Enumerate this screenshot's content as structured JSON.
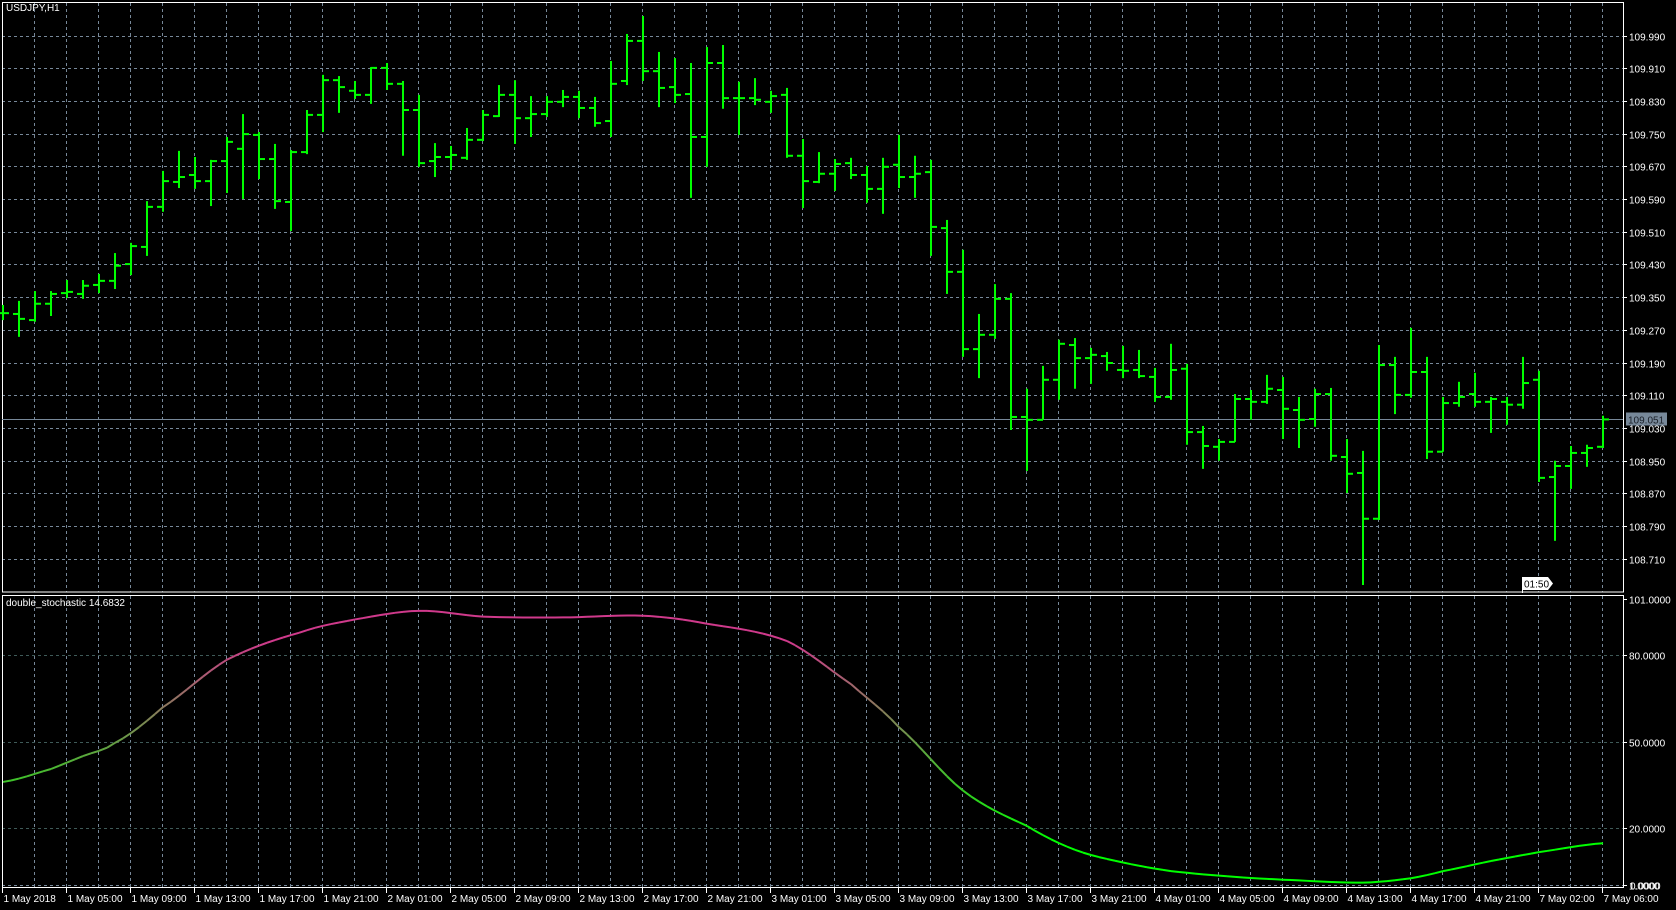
{
  "window": {
    "title": "USDJPY,H1"
  },
  "indicator": {
    "name": "double_stochastic",
    "value": "14.6832"
  },
  "countdown": "01:50",
  "colors": {
    "background": "#000000",
    "bars": "#00ff00",
    "grid": "#778899",
    "indicator_grid": "#3f5a58",
    "axis": "#ffffff",
    "price_line": "#778899",
    "indicator_low": "#00ff00",
    "indicator_high": "#d03a8c"
  },
  "chart_data": [
    {
      "type": "ohlc",
      "symbol": "USDJPY",
      "timeframe": "H1",
      "current_price": "109.051",
      "ylim": [
        108.7,
        110.05
      ],
      "y_tick_labels": [
        "109.990",
        "109.910",
        "109.830",
        "109.750",
        "109.670",
        "109.590",
        "109.510",
        "109.430",
        "109.350",
        "109.270",
        "109.190",
        "109.110",
        "109.030",
        "108.950",
        "108.870",
        "108.790",
        "108.710"
      ],
      "x_tick_labels": [
        "1 May 2018",
        "1 May 05:00",
        "1 May 09:00",
        "1 May 13:00",
        "1 May 17:00",
        "1 May 21:00",
        "2 May 01:00",
        "2 May 05:00",
        "2 May 09:00",
        "2 May 13:00",
        "2 May 17:00",
        "2 May 21:00",
        "3 May 01:00",
        "3 May 05:00",
        "3 May 09:00",
        "3 May 13:00",
        "3 May 17:00",
        "3 May 21:00",
        "4 May 01:00",
        "4 May 05:00",
        "4 May 09:00",
        "4 May 13:00",
        "4 May 17:00",
        "4 May 21:00",
        "7 May 02:00",
        "7 May 06:00"
      ],
      "ohlc_fields": [
        "open",
        "high",
        "low",
        "close"
      ],
      "bars": [
        [
          109.311,
          109.331,
          109.294,
          109.311
        ],
        [
          109.309,
          109.341,
          109.253,
          109.297
        ],
        [
          109.294,
          109.365,
          109.29,
          109.334
        ],
        [
          109.334,
          109.365,
          109.304,
          109.358
        ],
        [
          109.36,
          109.392,
          109.348,
          109.363
        ],
        [
          109.358,
          109.392,
          109.346,
          109.378
        ],
        [
          109.38,
          109.407,
          109.36,
          109.39
        ],
        [
          109.39,
          109.458,
          109.37,
          109.427
        ],
        [
          109.431,
          109.483,
          109.404,
          109.475
        ],
        [
          109.473,
          109.585,
          109.451,
          109.571
        ],
        [
          109.571,
          109.659,
          109.559,
          109.634
        ],
        [
          109.632,
          109.708,
          109.617,
          109.644
        ],
        [
          109.649,
          109.693,
          109.615,
          109.634
        ],
        [
          109.634,
          109.686,
          109.573,
          109.683
        ],
        [
          109.683,
          109.742,
          109.605,
          109.73
        ],
        [
          109.713,
          109.798,
          109.59,
          109.749
        ],
        [
          109.747,
          109.754,
          109.639,
          109.688
        ],
        [
          109.688,
          109.725,
          109.566,
          109.585
        ],
        [
          109.583,
          109.71,
          109.512,
          109.705
        ],
        [
          109.705,
          109.808,
          109.7,
          109.796
        ],
        [
          109.796,
          109.894,
          109.754,
          109.881
        ],
        [
          109.881,
          109.891,
          109.801,
          109.864
        ],
        [
          109.855,
          109.879,
          109.835,
          109.845
        ],
        [
          109.845,
          109.913,
          109.823,
          109.911
        ],
        [
          109.911,
          109.923,
          109.857,
          109.872
        ],
        [
          109.872,
          109.879,
          109.696,
          109.808
        ],
        [
          109.808,
          109.845,
          109.669,
          109.678
        ],
        [
          109.683,
          109.727,
          109.644,
          109.693
        ],
        [
          109.693,
          109.72,
          109.661,
          109.698
        ],
        [
          109.691,
          109.764,
          109.686,
          109.735
        ],
        [
          109.735,
          109.808,
          109.732,
          109.796
        ],
        [
          109.793,
          109.869,
          109.791,
          109.845
        ],
        [
          109.845,
          109.881,
          109.725,
          109.788
        ],
        [
          109.788,
          109.842,
          109.742,
          109.798
        ],
        [
          109.798,
          109.842,
          109.791,
          109.828
        ],
        [
          109.828,
          109.857,
          109.815,
          109.84
        ],
        [
          109.84,
          109.855,
          109.788,
          109.813
        ],
        [
          109.813,
          109.84,
          109.767,
          109.776
        ],
        [
          109.781,
          109.928,
          109.742,
          109.872
        ],
        [
          109.879,
          109.994,
          109.869,
          109.977
        ],
        [
          109.977,
          110.038,
          109.879,
          109.903
        ],
        [
          109.903,
          109.95,
          109.815,
          109.862
        ],
        [
          109.864,
          109.935,
          109.825,
          109.845
        ],
        [
          109.847,
          109.923,
          109.593,
          109.742
        ],
        [
          109.742,
          109.962,
          109.669,
          109.923
        ],
        [
          109.923,
          109.967,
          109.811,
          109.837
        ],
        [
          109.837,
          109.877,
          109.747,
          109.837
        ],
        [
          109.837,
          109.886,
          109.82,
          109.833
        ],
        [
          109.828,
          109.855,
          109.801,
          109.842
        ],
        [
          109.845,
          109.862,
          109.691,
          109.696
        ],
        [
          109.696,
          109.737,
          109.568,
          109.634
        ],
        [
          109.632,
          109.705,
          109.629,
          109.652
        ],
        [
          109.652,
          109.688,
          109.61,
          109.676
        ],
        [
          109.678,
          109.691,
          109.639,
          109.649
        ],
        [
          109.649,
          109.671,
          109.581,
          109.615
        ],
        [
          109.615,
          109.691,
          109.554,
          109.669
        ],
        [
          109.674,
          109.747,
          109.617,
          109.644
        ],
        [
          109.644,
          109.696,
          109.593,
          109.652
        ],
        [
          109.656,
          109.686,
          109.451,
          109.522
        ],
        [
          109.519,
          109.539,
          109.358,
          109.412
        ],
        [
          109.412,
          109.466,
          109.204,
          109.223
        ],
        [
          109.223,
          109.309,
          109.152,
          109.258
        ],
        [
          109.258,
          109.382,
          109.248,
          109.346
        ],
        [
          109.346,
          109.36,
          109.025,
          109.057
        ],
        [
          109.057,
          109.126,
          108.925,
          109.05
        ],
        [
          109.05,
          109.182,
          109.05,
          109.148
        ],
        [
          109.148,
          109.246,
          109.099,
          109.236
        ],
        [
          109.233,
          109.25,
          109.126,
          109.201
        ],
        [
          109.201,
          109.226,
          109.138,
          109.209
        ],
        [
          109.206,
          109.216,
          109.17,
          109.189
        ],
        [
          109.172,
          109.231,
          109.152,
          109.17
        ],
        [
          109.172,
          109.221,
          109.152,
          109.157
        ],
        [
          109.155,
          109.177,
          109.094,
          109.106
        ],
        [
          109.106,
          109.236,
          109.099,
          109.172
        ],
        [
          109.175,
          109.187,
          108.989,
          109.02
        ],
        [
          109.02,
          109.035,
          108.93,
          108.986
        ],
        [
          108.984,
          109.003,
          108.95,
          108.996
        ],
        [
          108.996,
          109.113,
          108.996,
          109.101
        ],
        [
          109.101,
          109.123,
          109.05,
          109.094
        ],
        [
          109.094,
          109.16,
          109.089,
          109.126
        ],
        [
          109.123,
          109.155,
          109.003,
          109.077
        ],
        [
          109.074,
          109.106,
          108.981,
          109.05
        ],
        [
          109.052,
          109.126,
          109.033,
          109.113
        ],
        [
          109.113,
          109.128,
          108.95,
          108.962
        ],
        [
          108.959,
          109.003,
          108.871,
          108.918
        ],
        [
          108.92,
          108.974,
          108.646,
          108.808
        ],
        [
          108.808,
          109.233,
          108.805,
          109.184
        ],
        [
          109.184,
          109.204,
          109.064,
          109.111
        ],
        [
          109.111,
          109.275,
          109.104,
          109.167
        ],
        [
          109.167,
          109.204,
          108.954,
          108.972
        ],
        [
          108.972,
          109.106,
          108.972,
          109.091
        ],
        [
          109.091,
          109.143,
          109.082,
          109.106
        ],
        [
          109.113,
          109.165,
          109.082,
          109.094
        ],
        [
          109.094,
          109.106,
          109.018,
          109.101
        ],
        [
          109.094,
          109.106,
          109.038,
          109.087
        ],
        [
          109.087,
          109.204,
          109.077,
          109.14
        ],
        [
          109.148,
          109.17,
          108.898,
          108.908
        ],
        [
          108.91,
          108.95,
          108.754,
          108.937
        ],
        [
          108.937,
          108.986,
          108.881,
          108.969
        ],
        [
          108.969,
          108.989,
          108.935,
          108.981
        ],
        [
          108.984,
          109.06,
          108.981,
          109.051
        ]
      ]
    },
    {
      "type": "line",
      "name": "double_stochastic",
      "ylim": [
        1,
        101
      ],
      "y_tick_labels": [
        "101.0000",
        "80.0000",
        "50.0000",
        "20.0000",
        "1.0000",
        "0.0000"
      ],
      "y_tick_values": [
        101,
        80,
        50,
        20,
        1,
        0
      ],
      "points_bar_value": [
        [
          0,
          36
        ],
        [
          3,
          40.5
        ],
        [
          5,
          45
        ],
        [
          7,
          49.6
        ],
        [
          10,
          62
        ],
        [
          14,
          78.5
        ],
        [
          18.6,
          88
        ],
        [
          22,
          92.5
        ],
        [
          26,
          95.5
        ],
        [
          30,
          93.5
        ],
        [
          35,
          93.2
        ],
        [
          40,
          93.8
        ],
        [
          44,
          91
        ],
        [
          49,
          85
        ],
        [
          53,
          70
        ],
        [
          56,
          55
        ],
        [
          60,
          33
        ],
        [
          64,
          20.7
        ],
        [
          67,
          12.4
        ],
        [
          70,
          8
        ],
        [
          73,
          5
        ],
        [
          77,
          3
        ],
        [
          80,
          2
        ],
        [
          85,
          1
        ],
        [
          88,
          2.5
        ],
        [
          90,
          5
        ],
        [
          93,
          8.5
        ],
        [
          96,
          11.6
        ],
        [
          100,
          14.6832
        ]
      ]
    }
  ]
}
